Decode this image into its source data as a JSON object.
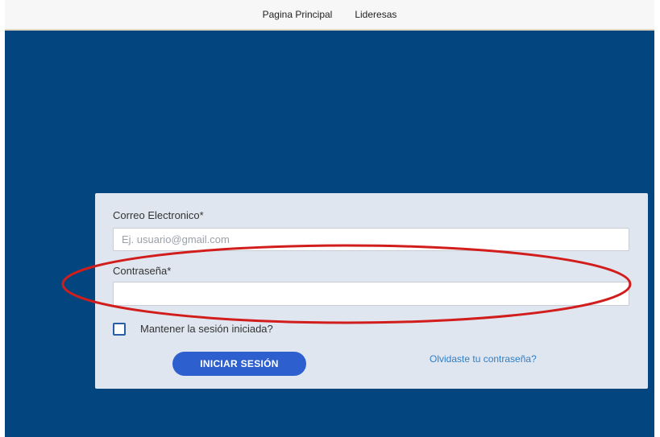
{
  "nav": {
    "items": [
      {
        "label": "Pagina Principal"
      },
      {
        "label": "Lideresas"
      }
    ]
  },
  "login": {
    "email_label": "Correo Electronico*",
    "email_placeholder": "Ej. usuario@gmail.com",
    "email_value": "",
    "password_label": "Contraseña*",
    "password_value": "",
    "remember_label": "Mantener la sesión iniciada?",
    "remember_checked": false,
    "submit_label": "INICIAR SESIÓN",
    "forgot_label": "Olvidaste tu contraseña?"
  },
  "colors": {
    "hero_background": "#03467f",
    "card_background": "#dfe6ef",
    "button": "#2e5fcf",
    "link": "#2f7ec7",
    "annotation_ellipse": "#d21d1d"
  }
}
